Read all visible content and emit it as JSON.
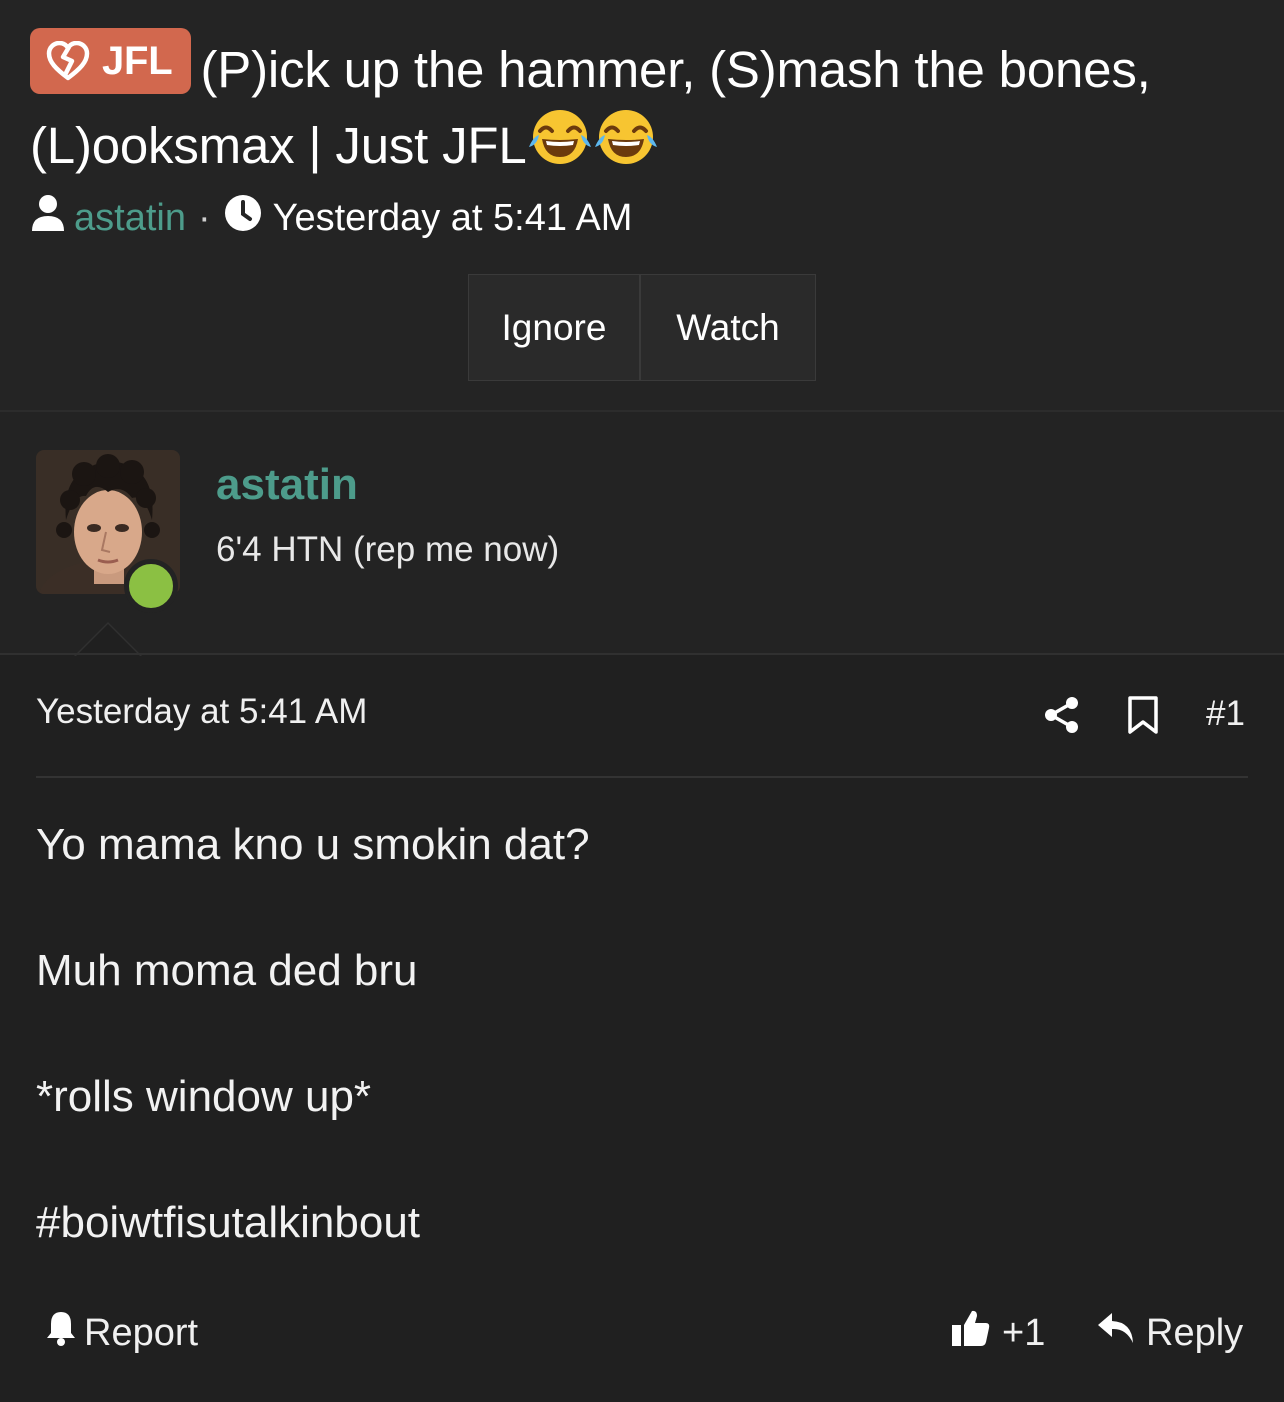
{
  "thread": {
    "prefix": "JFL",
    "prefix_icon": "broken-heart-icon",
    "title": "(P)ick up the hammer, (S)mash the bones, (L)ooksmax | Just JFL",
    "title_emojis": [
      "😂",
      "😂"
    ],
    "author": "astatin",
    "meta_separator": "·",
    "posted": "Yesterday at 5:41 AM",
    "buttons": {
      "ignore": "Ignore",
      "watch": "Watch"
    }
  },
  "post": {
    "author": "astatin",
    "user_title": "6'4 HTN (rep me now)",
    "online": true,
    "timestamp": "Yesterday at 5:41 AM",
    "number": "#1",
    "body": [
      "Yo mama kno u smokin dat?",
      "Muh moma ded bru",
      "*rolls window up*",
      "#boiwtfisutalkinbout"
    ],
    "footer": {
      "report": "Report",
      "like_count": "+1",
      "reply": "Reply"
    }
  },
  "colors": {
    "background": "#202020",
    "header_bg": "#242424",
    "prefix_bg": "#d2684e",
    "username": "#4d9c8b",
    "online_dot": "#8bc043"
  }
}
